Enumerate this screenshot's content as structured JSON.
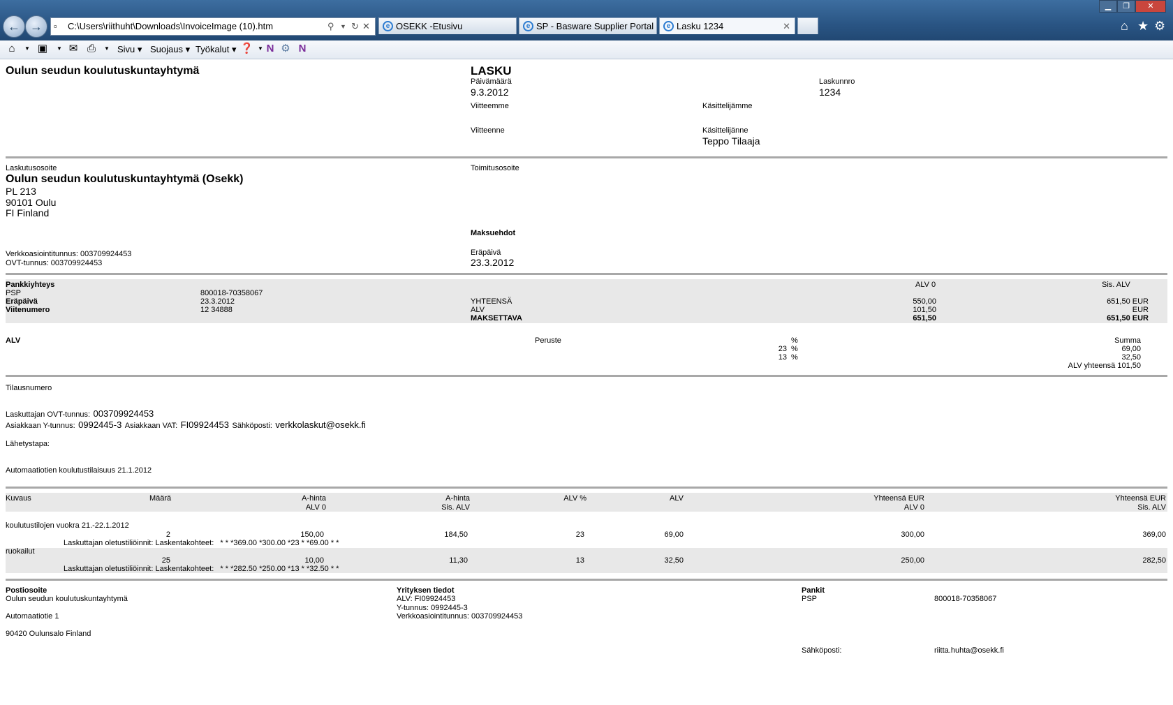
{
  "browser": {
    "address": "C:\\Users\\riithuht\\Downloads\\InvoiceImage (10).htm",
    "tabs": [
      {
        "label": "OSEKK -Etusivu"
      },
      {
        "label": "SP - Basware Supplier Portal"
      },
      {
        "label": "Lasku 1234"
      }
    ],
    "menu": {
      "page": "Sivu",
      "safety": "Suojaus",
      "tools": "Työkalut"
    }
  },
  "invoice": {
    "company": "Oulun seudun koulutuskuntayhtymä",
    "doc_title": "LASKU",
    "date_label": "Päivämäärä",
    "date": "9.3.2012",
    "number_label": "Laskunnro",
    "number": "1234",
    "our_ref_label": "Viitteemme",
    "our_handler_label": "Käsittelijämme",
    "your_ref_label": "Viitteenne",
    "your_handler_label": "Käsittelijänne",
    "your_handler": "Teppo Tilaaja",
    "billing_label": "Laskutusosoite",
    "billing_name": "Oulun seudun koulutuskuntayhtymä (Osekk)",
    "billing_line1": "PL 213",
    "billing_line2": "90101 Oulu",
    "billing_line3": "FI Finland",
    "delivery_label": "Toimitusosoite",
    "terms_label": "Maksuehdot",
    "due_label": "Eräpäivä",
    "due": "23.3.2012",
    "einvoice_id": "Verkkoasiointitunnus: 003709924453",
    "ovt_id": "OVT-tunnus: 003709924453"
  },
  "bank": {
    "header": "Pankkiyhteys",
    "psp_label": "PSP",
    "psp": "800018-70358067",
    "due_label": "Eräpäivä",
    "due": "23.3.2012",
    "ref_label": "Viitenumero",
    "ref": "12 34888"
  },
  "totals": {
    "col1": "ALV 0",
    "col2": "Sis. ALV",
    "sum_label": "YHTEENSÄ",
    "sum_a": "550,00",
    "sum_b": "651,50 EUR",
    "vat_label": "ALV",
    "vat_a": "101,50",
    "vat_b": "EUR",
    "pay_label": "MAKSETTAVA",
    "pay_a": "651,50",
    "pay_b": "651,50 EUR"
  },
  "vat": {
    "title": "ALV",
    "basis": "Peruste",
    "pct": "%",
    "sum": "Summa",
    "rows": [
      {
        "pct": "23",
        "unit": "%",
        "sum": "69,00"
      },
      {
        "pct": "13",
        "unit": "%",
        "sum": "32,50"
      }
    ],
    "total": "ALV yhteensä 101,50"
  },
  "order": {
    "order_label": "Tilausnumero",
    "ovt_label": "Laskuttajan OVT-tunnus:",
    "ovt": "003709924453",
    "ytunnus_label": "Asiakkaan Y-tunnus:",
    "ytunnus": "0992445-3",
    "vatnum_label": "Asiakkaan VAT:",
    "vatnum": "FI09924453",
    "email_label": "Sähköposti:",
    "email": "verkkolaskut@osekk.fi",
    "send_label": "Lähetystapa:",
    "description": "Automaatiotien koulutustilaisuus 21.1.2012"
  },
  "rows_header": {
    "desc": "Kuvaus",
    "qty": "Määrä",
    "price": "A-hinta",
    "price_sub": "ALV 0",
    "price2": "A-hinta",
    "price2_sub": "Sis. ALV",
    "vatpct": "ALV %",
    "vat": "ALV",
    "tot": "Yhteensä EUR",
    "tot_sub": "ALV 0",
    "tot2": "Yhteensä EUR",
    "tot2_sub": "Sis. ALV"
  },
  "rows": [
    {
      "desc": "koulutustilojen vuokra 21.-22.1.2012",
      "qty": "2",
      "price": "150,00",
      "price2": "184,50",
      "vatpct": "23",
      "vat": "69,00",
      "tot": "300,00",
      "tot2": "369,00",
      "acc": "Laskuttajan oletustiliöinnit: Laskentakohteet:   * * *369.00 *300.00 *23 * *69.00 * *"
    },
    {
      "desc": "ruokailut",
      "qty": "25",
      "price": "10,00",
      "price2": "11,30",
      "vatpct": "13",
      "vat": "32,50",
      "tot": "250,00",
      "tot2": "282,50",
      "acc": "Laskuttajan oletustiliöinnit: Laskentakohteet:   * * *282.50 *250.00 *13 * *32.50 * *"
    }
  ],
  "footer": {
    "post_label": "Postiosoite",
    "post1": "Oulun seudun koulutuskuntayhtymä",
    "post2": "Automaatiotie 1",
    "post3": "90420 Oulunsalo Finland",
    "company_label": "Yrityksen tiedot",
    "co1": "ALV: FI09924453",
    "co2": "Y-tunnus: 0992445-3",
    "co3": "Verkkoasiointitunnus: 003709924453",
    "banks_label": "Pankit",
    "bank_name": "PSP",
    "bank_acc": "800018-70358067",
    "email_label": "Sähköposti:",
    "email": "riitta.huhta@osekk.fi"
  }
}
